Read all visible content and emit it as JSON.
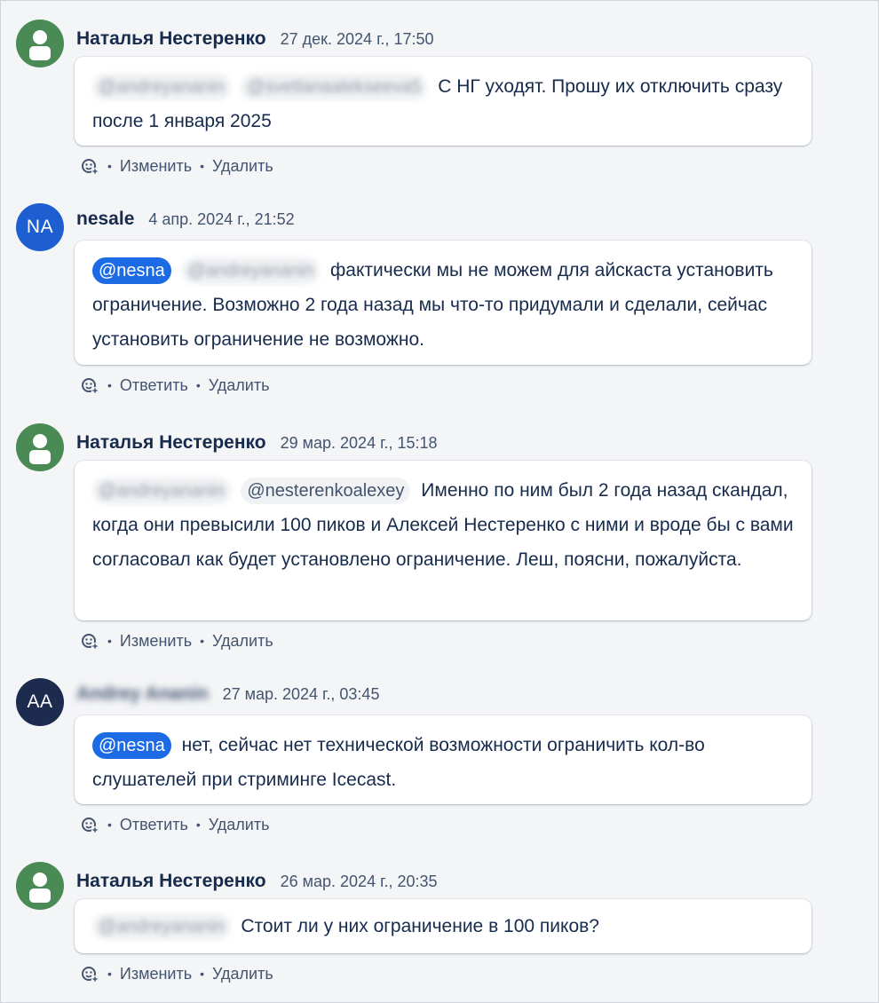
{
  "comments": [
    {
      "author": "Наталья Нестеренко",
      "date": "27 дек. 2024 г., 17:50",
      "mentions": [
        "@andreyananin",
        "@svetlanaalekseeva5"
      ],
      "text": "С НГ уходят. Прошу их отключить сразу после 1 января 2025",
      "actions": [
        "Изменить",
        "Удалить"
      ]
    },
    {
      "author": "nesale",
      "avatar_initials": "NA",
      "date": "4 апр. 2024 г., 21:52",
      "mentions": [
        "@nesna",
        "@andreyananin"
      ],
      "text": "фактически мы не можем для айскаста установить ограничение. Возможно 2 года назад мы что-то придумали и сделали, сейчас установить ограничение не возможно.",
      "actions": [
        "Ответить",
        "Удалить"
      ]
    },
    {
      "author": "Наталья Нестеренко",
      "date": "29 мар. 2024 г., 15:18",
      "mentions": [
        "@andreyananin",
        "@nesterenkoalexey"
      ],
      "text": "Именно по ним был 2 года назад скандал, когда они превысили 100 пиков и Алексей Нестеренко с ними и вроде бы с вами согласовал как будет установлено ограничение. Леш, поясни, пожалуйста.",
      "actions": [
        "Изменить",
        "Удалить"
      ]
    },
    {
      "author": "Andrey Ananin",
      "avatar_initials": "AA",
      "date": "27 мар. 2024 г., 03:45",
      "mentions": [
        "@nesna"
      ],
      "text": "нет, сейчас нет технической возможности ограничить кол-во слушателей при стриминге Icecast.",
      "actions": [
        "Ответить",
        "Удалить"
      ]
    },
    {
      "author": "Наталья Нестеренко",
      "date": "26 мар. 2024 г., 20:35",
      "mentions": [
        "@andreyananin"
      ],
      "text": "Стоит ли у них ограничение в 100 пиков?",
      "actions": [
        "Изменить",
        "Удалить"
      ]
    }
  ],
  "colors": {
    "avatar_user": "#4a8a55",
    "avatar_nesale": "#1d5fd1",
    "avatar_aa": "#1d2b4f",
    "mention_self": "#1d6ae5"
  },
  "separator": "•"
}
